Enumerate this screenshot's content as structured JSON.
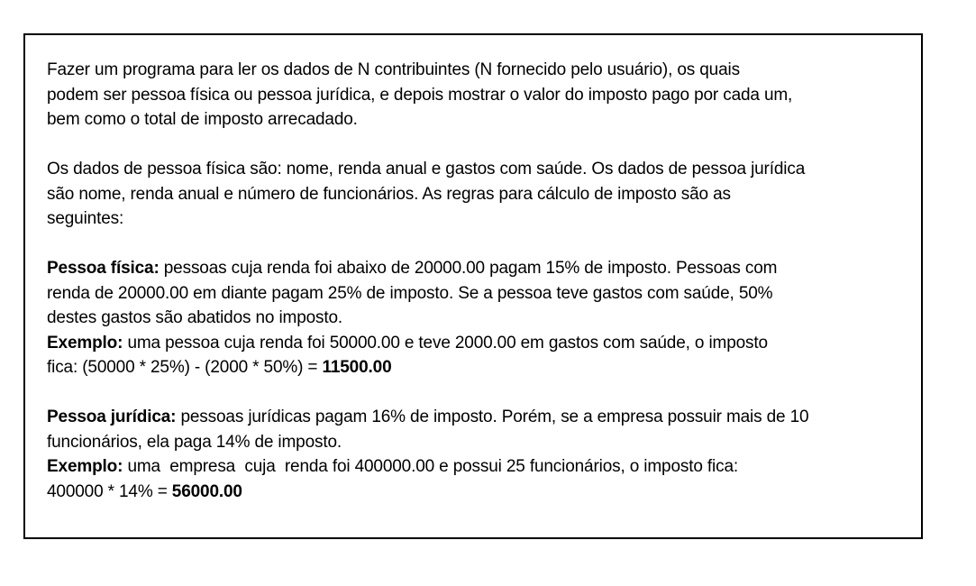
{
  "intro": {
    "line1": "Fazer um programa para ler os dados de N contribuintes (N fornecido pelo usuário), os quais",
    "line2": "podem ser pessoa física ou pessoa jurídica, e depois mostrar o valor do imposto pago por cada um,",
    "line3": "bem como o total de imposto arrecadado."
  },
  "data_description": {
    "line1": "Os dados de pessoa física são: nome, renda anual e gastos com saúde. Os dados de pessoa jurídica",
    "line2": "são nome, renda anual e número de funcionários. As regras para cálculo de imposto são as",
    "line3": "seguintes:"
  },
  "pessoa_fisica": {
    "heading": "Pessoa física:",
    "line1_rest": " pessoas cuja renda foi abaixo de 20000.00 pagam 15% de imposto. Pessoas com",
    "line2": "renda de 20000.00 em diante pagam 25% de imposto. Se a pessoa teve gastos com saúde, 50%",
    "line3": "destes gastos são abatidos no imposto.",
    "example_label": "Exemplo:",
    "example_line1_rest": " uma pessoa cuja renda foi 50000.00 e teve 2000.00 em gastos com saúde, o imposto",
    "example_line2_prefix": "fica: (50000 * 25%) - (2000 * 50%) = ",
    "example_result": "11500.00"
  },
  "pessoa_juridica": {
    "heading": "Pessoa jurídica:",
    "line1_rest": " pessoas jurídicas pagam 16% de imposto. Porém, se a empresa possuir mais de 10",
    "line2": "funcionários, ela paga 14% de imposto.",
    "example_label": "Exemplo:",
    "example_line1_rest": " uma  empresa  cuja  renda foi 400000.00 e possui 25 funcionários, o imposto fica:",
    "example_line2_prefix": "400000 * 14% = ",
    "example_result": "56000.00"
  }
}
